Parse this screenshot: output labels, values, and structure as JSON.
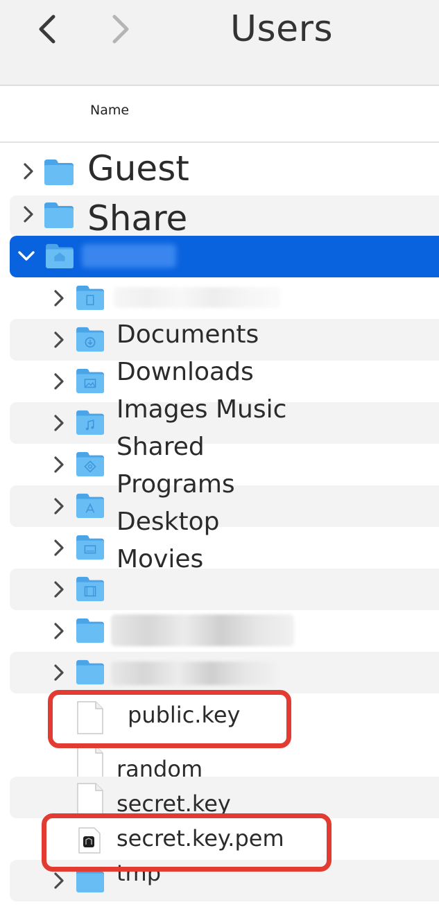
{
  "window": {
    "title": "Users"
  },
  "toolbar": {
    "back_icon": "chevron-left-icon",
    "forward_icon": "chevron-right-icon"
  },
  "columns": {
    "name": "Name"
  },
  "top_level": [
    {
      "label": "Guest"
    },
    {
      "label": "Share"
    }
  ],
  "home_folder": {
    "label": ""
  },
  "subfolders": [
    {
      "label": "Documents"
    },
    {
      "label": "Downloads"
    },
    {
      "label": "Images Music"
    },
    {
      "label": "Shared"
    },
    {
      "label": "Programs"
    },
    {
      "label": "Desktop"
    },
    {
      "label": "Movies"
    }
  ],
  "files": [
    {
      "label": "public.key"
    },
    {
      "label": "random"
    },
    {
      "label": "secret.key"
    },
    {
      "label": "secret.key.pem"
    }
  ],
  "tmp_folder": {
    "label": "tmp"
  },
  "colors": {
    "accent": "#0a63de",
    "folder": "#5ab0ef",
    "highlight": "#e23b32"
  }
}
